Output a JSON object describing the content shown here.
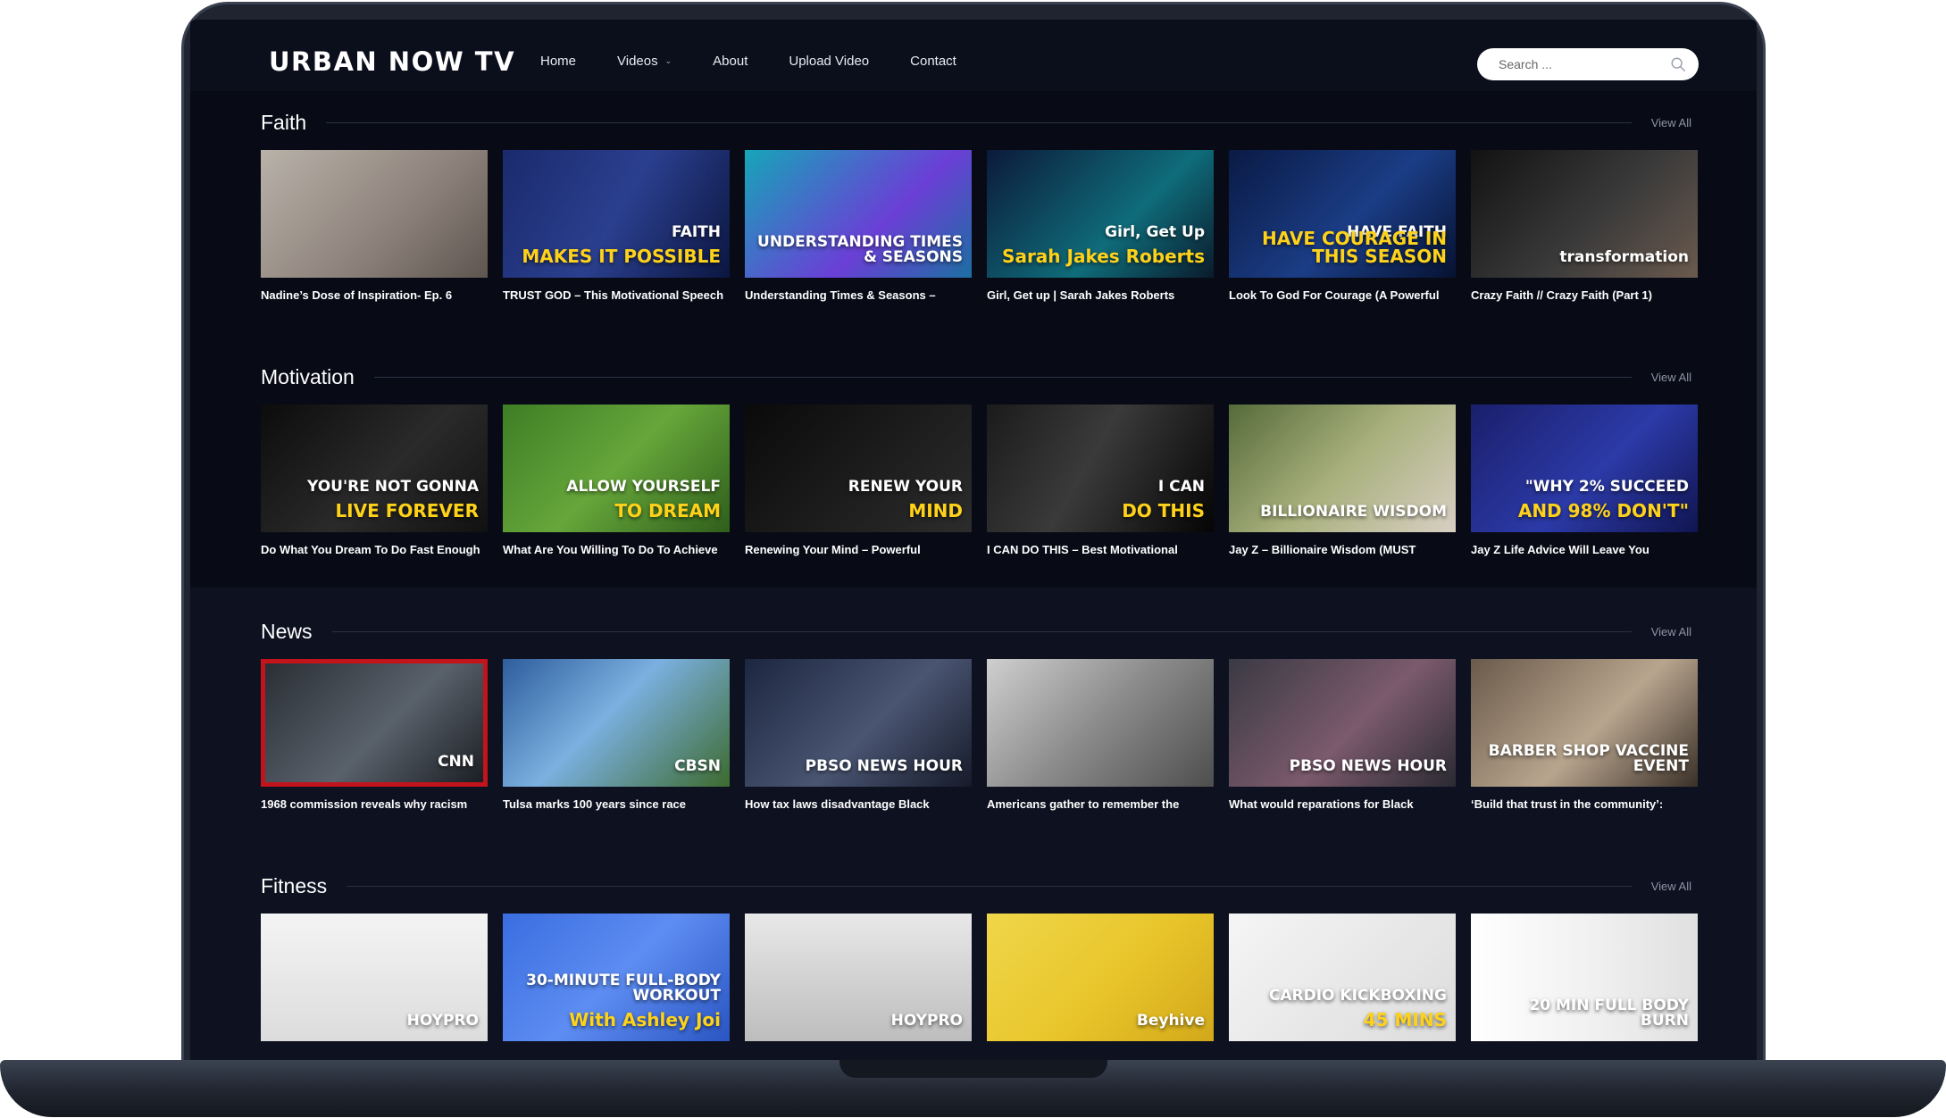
{
  "site": {
    "logo": "URBAN NOW TV",
    "nav": [
      {
        "label": "Home"
      },
      {
        "label": "Videos",
        "has_dropdown": true
      },
      {
        "label": "About"
      },
      {
        "label": "Upload Video"
      },
      {
        "label": "Contact"
      }
    ],
    "search": {
      "placeholder": "Search ..."
    }
  },
  "view_all_label": "View All",
  "sections": [
    {
      "title": "Faith",
      "cards": [
        {
          "title": "Nadine’s Dose of Inspiration- Ep. 6",
          "thumb_text": "",
          "bg": "linear-gradient(135deg,#b9b2a9,#8b8079 60%,#5e5550)"
        },
        {
          "title": "TRUST GOD – This Motivational Speech",
          "thumb_text": "FAITH",
          "thumb_sub": "MAKES IT POSSIBLE",
          "bg": "linear-gradient(120deg,#1a2a6c,#2b3f8f 50%,#0b1640)"
        },
        {
          "title": "Understanding Times & Seasons –",
          "thumb_text": "UNDERSTANDING TIMES & SEASONS",
          "bg": "linear-gradient(135deg,#16a5b8,#6a3fd6 60%,#1c6fa1)"
        },
        {
          "title": "Girl, Get up | Sarah Jakes Roberts",
          "thumb_text": "Girl, Get Up",
          "thumb_sub": "Sarah Jakes Roberts",
          "bg": "linear-gradient(135deg,#0c1a3a,#0f6c7a 60%,#0a1b2c)"
        },
        {
          "title": "Look To God For Courage (A Powerful",
          "thumb_text": "HAVE FAITH",
          "thumb_sub": "HAVE COURAGE IN THIS SEASON",
          "bg": "linear-gradient(135deg,#0a1a44,#1b3d86 55%,#061231)"
        },
        {
          "title": "Crazy Faith // Crazy Faith (Part 1)",
          "thumb_text": "transformation",
          "bg": "linear-gradient(135deg,#121212,#3a3a3a 55%,#6b5a4e)"
        }
      ]
    },
    {
      "title": "Motivation",
      "cards": [
        {
          "title": "Do What You Dream To Do Fast Enough",
          "thumb_text": "YOU'RE NOT GONNA",
          "thumb_sub": "LIVE FOREVER",
          "bg": "linear-gradient(135deg,#0c0c0c,#2a2a2a 55%,#111)"
        },
        {
          "title": "What Are You Willing To Do To Achieve",
          "thumb_text": "ALLOW YOURSELF",
          "thumb_sub": "TO DREAM",
          "bg": "linear-gradient(135deg,#3f7d26,#66a63a 50%,#2f5e1b)"
        },
        {
          "title": "Renewing Your Mind – Powerful",
          "thumb_text": "RENEW YOUR",
          "thumb_sub": "MIND",
          "bg": "linear-gradient(135deg,#0a0a0a,#1d1d1d 55%,#2c2c2c)"
        },
        {
          "title": "I CAN DO THIS – Best Motivational",
          "thumb_text": "I CAN",
          "thumb_sub": "DO THIS",
          "bg": "linear-gradient(120deg,#1b1b1b,#3a3a3a 45%,#050505)"
        },
        {
          "title": "Jay Z – Billionaire Wisdom (MUST",
          "thumb_text": "BILLIONAIRE WISDOM",
          "bg": "linear-gradient(135deg,#556b3a,#a8b07c 50%,#d8cfc3)"
        },
        {
          "title": "Jay Z Life Advice Will Leave You",
          "thumb_text": "\"WHY 2% SUCCEED",
          "thumb_sub": "AND 98% DON'T\"",
          "bg": "linear-gradient(135deg,#1a1f6b,#2c3aa8 55%,#101550)"
        }
      ]
    },
    {
      "title": "News",
      "cards": [
        {
          "title": "1968 commission reveals why racism",
          "thumb_text": "CNN",
          "bg": "linear-gradient(135deg,#2a2f35,#59616b 55%,#1b1f24)",
          "border": "#c2141a"
        },
        {
          "title": "Tulsa marks 100 years since race",
          "thumb_text": "CBSN",
          "bg": "linear-gradient(135deg,#2e5d9c,#7bb0e0 45%,#3d6b2f)"
        },
        {
          "title": "How tax laws disadvantage Black",
          "thumb_text": "PBSO NEWS HOUR",
          "bg": "linear-gradient(135deg,#1c2640,#4a5572 55%,#161b2a)"
        },
        {
          "title": "Americans gather to remember the",
          "thumb_text": "",
          "bg": "linear-gradient(135deg,#cfcfcf,#8a8a8a 50%,#4e4e4e)"
        },
        {
          "title": "What would reparations for Black",
          "thumb_text": "PBSO NEWS HOUR",
          "bg": "linear-gradient(135deg,#3a3a44,#7b5a6c 55%,#2a2a33)"
        },
        {
          "title": "‘Build that trust in the community’:",
          "thumb_text": "BARBER SHOP VACCINE EVENT",
          "bg": "linear-gradient(135deg,#6a5a4a,#b8a58e 55%,#3a3028)"
        }
      ]
    },
    {
      "title": "Fitness",
      "cards": [
        {
          "title": "",
          "thumb_text": "HOYPRO",
          "bg": "linear-gradient(180deg,#f4f4f4,#dcdcdc)"
        },
        {
          "title": "",
          "thumb_text": "30-MINUTE FULL-BODY WORKOUT",
          "thumb_sub": "With Ashley Joi",
          "bg": "linear-gradient(135deg,#3a6de0,#5d8df2 50%,#2a55c2)"
        },
        {
          "title": "",
          "thumb_text": "HOYPRO",
          "bg": "linear-gradient(180deg,#e8e8e8,#bdbdbd)"
        },
        {
          "title": "",
          "thumb_text": "Beyhive",
          "bg": "linear-gradient(135deg,#f0d64a,#e8c52a 55%,#d2a81a)"
        },
        {
          "title": "",
          "thumb_text": "CARDIO KICKBOXING",
          "thumb_sub": "45 MINS",
          "bg": "linear-gradient(135deg,#f5f5f5,#dcdcdc)"
        },
        {
          "title": "",
          "thumb_text": "20 MIN FULL BODY BURN",
          "bg": "linear-gradient(90deg,#ffffff,#f0f0f0 55%,#e0e0e0)"
        }
      ]
    }
  ]
}
